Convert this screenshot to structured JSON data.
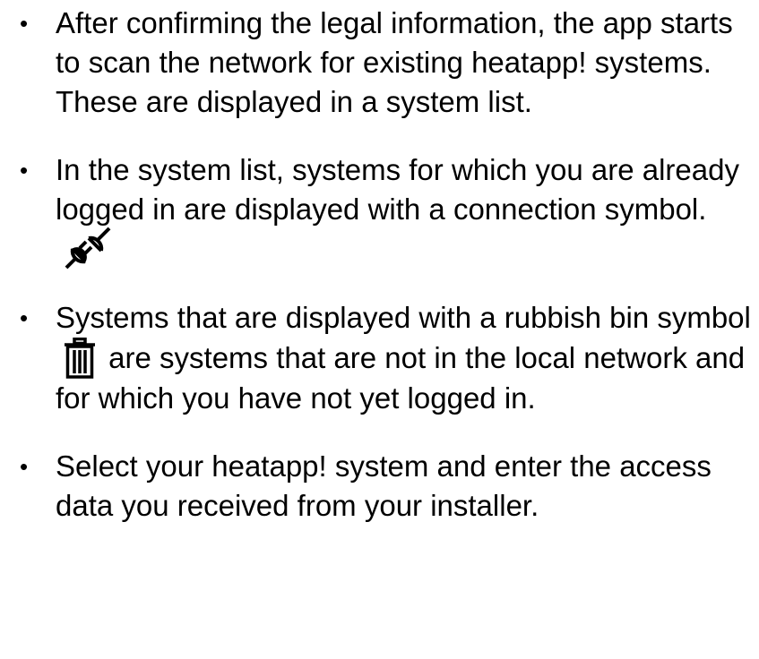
{
  "bullets": [
    {
      "text": "After confirming the legal information, the app starts to scan the network for existing heatapp! systems. These are displayed in a system list."
    },
    {
      "text": "In the system list, systems for which you are already logged in are displayed with a connection symbol.",
      "icon": "plug-icon"
    },
    {
      "text_before": "Systems that are displayed with a rubbish bin symbol",
      "icon": "trash-icon",
      "text_after": "are systems that are not in the local network and for which you have not yet logged in."
    },
    {
      "text": "Select your heatapp! system and enter the access data you received from your installer."
    }
  ],
  "bullet_char": "•"
}
